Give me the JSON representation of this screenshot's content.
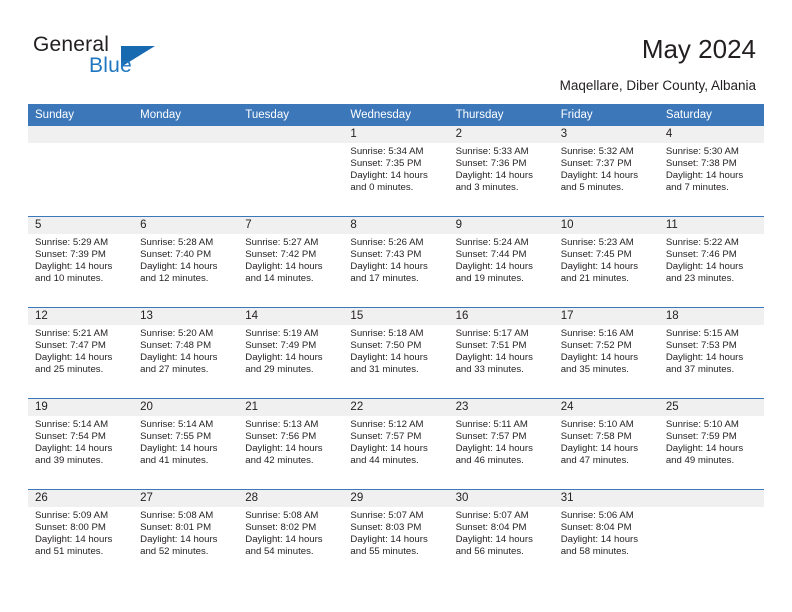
{
  "logo": {
    "word_general": "General",
    "word_blue": "Blue"
  },
  "header": {
    "title": "May 2024",
    "subtitle": "Maqellare, Diber County, Albania"
  },
  "calendar": {
    "weekday_headers": [
      "Sunday",
      "Monday",
      "Tuesday",
      "Wednesday",
      "Thursday",
      "Friday",
      "Saturday"
    ],
    "labels": {
      "sunrise": "Sunrise:",
      "sunset": "Sunset:",
      "daylight": "Daylight:"
    },
    "weeks": [
      [
        {
          "day": "",
          "empty": true
        },
        {
          "day": "",
          "empty": true
        },
        {
          "day": "",
          "empty": true
        },
        {
          "day": "1",
          "sunrise": "Sunrise: 5:34 AM",
          "sunset": "Sunset: 7:35 PM",
          "daylight1": "Daylight: 14 hours",
          "daylight2": "and 0 minutes."
        },
        {
          "day": "2",
          "sunrise": "Sunrise: 5:33 AM",
          "sunset": "Sunset: 7:36 PM",
          "daylight1": "Daylight: 14 hours",
          "daylight2": "and 3 minutes."
        },
        {
          "day": "3",
          "sunrise": "Sunrise: 5:32 AM",
          "sunset": "Sunset: 7:37 PM",
          "daylight1": "Daylight: 14 hours",
          "daylight2": "and 5 minutes."
        },
        {
          "day": "4",
          "sunrise": "Sunrise: 5:30 AM",
          "sunset": "Sunset: 7:38 PM",
          "daylight1": "Daylight: 14 hours",
          "daylight2": "and 7 minutes."
        }
      ],
      [
        {
          "day": "5",
          "sunrise": "Sunrise: 5:29 AM",
          "sunset": "Sunset: 7:39 PM",
          "daylight1": "Daylight: 14 hours",
          "daylight2": "and 10 minutes."
        },
        {
          "day": "6",
          "sunrise": "Sunrise: 5:28 AM",
          "sunset": "Sunset: 7:40 PM",
          "daylight1": "Daylight: 14 hours",
          "daylight2": "and 12 minutes."
        },
        {
          "day": "7",
          "sunrise": "Sunrise: 5:27 AM",
          "sunset": "Sunset: 7:42 PM",
          "daylight1": "Daylight: 14 hours",
          "daylight2": "and 14 minutes."
        },
        {
          "day": "8",
          "sunrise": "Sunrise: 5:26 AM",
          "sunset": "Sunset: 7:43 PM",
          "daylight1": "Daylight: 14 hours",
          "daylight2": "and 17 minutes."
        },
        {
          "day": "9",
          "sunrise": "Sunrise: 5:24 AM",
          "sunset": "Sunset: 7:44 PM",
          "daylight1": "Daylight: 14 hours",
          "daylight2": "and 19 minutes."
        },
        {
          "day": "10",
          "sunrise": "Sunrise: 5:23 AM",
          "sunset": "Sunset: 7:45 PM",
          "daylight1": "Daylight: 14 hours",
          "daylight2": "and 21 minutes."
        },
        {
          "day": "11",
          "sunrise": "Sunrise: 5:22 AM",
          "sunset": "Sunset: 7:46 PM",
          "daylight1": "Daylight: 14 hours",
          "daylight2": "and 23 minutes."
        }
      ],
      [
        {
          "day": "12",
          "sunrise": "Sunrise: 5:21 AM",
          "sunset": "Sunset: 7:47 PM",
          "daylight1": "Daylight: 14 hours",
          "daylight2": "and 25 minutes."
        },
        {
          "day": "13",
          "sunrise": "Sunrise: 5:20 AM",
          "sunset": "Sunset: 7:48 PM",
          "daylight1": "Daylight: 14 hours",
          "daylight2": "and 27 minutes."
        },
        {
          "day": "14",
          "sunrise": "Sunrise: 5:19 AM",
          "sunset": "Sunset: 7:49 PM",
          "daylight1": "Daylight: 14 hours",
          "daylight2": "and 29 minutes."
        },
        {
          "day": "15",
          "sunrise": "Sunrise: 5:18 AM",
          "sunset": "Sunset: 7:50 PM",
          "daylight1": "Daylight: 14 hours",
          "daylight2": "and 31 minutes."
        },
        {
          "day": "16",
          "sunrise": "Sunrise: 5:17 AM",
          "sunset": "Sunset: 7:51 PM",
          "daylight1": "Daylight: 14 hours",
          "daylight2": "and 33 minutes."
        },
        {
          "day": "17",
          "sunrise": "Sunrise: 5:16 AM",
          "sunset": "Sunset: 7:52 PM",
          "daylight1": "Daylight: 14 hours",
          "daylight2": "and 35 minutes."
        },
        {
          "day": "18",
          "sunrise": "Sunrise: 5:15 AM",
          "sunset": "Sunset: 7:53 PM",
          "daylight1": "Daylight: 14 hours",
          "daylight2": "and 37 minutes."
        }
      ],
      [
        {
          "day": "19",
          "sunrise": "Sunrise: 5:14 AM",
          "sunset": "Sunset: 7:54 PM",
          "daylight1": "Daylight: 14 hours",
          "daylight2": "and 39 minutes."
        },
        {
          "day": "20",
          "sunrise": "Sunrise: 5:14 AM",
          "sunset": "Sunset: 7:55 PM",
          "daylight1": "Daylight: 14 hours",
          "daylight2": "and 41 minutes."
        },
        {
          "day": "21",
          "sunrise": "Sunrise: 5:13 AM",
          "sunset": "Sunset: 7:56 PM",
          "daylight1": "Daylight: 14 hours",
          "daylight2": "and 42 minutes."
        },
        {
          "day": "22",
          "sunrise": "Sunrise: 5:12 AM",
          "sunset": "Sunset: 7:57 PM",
          "daylight1": "Daylight: 14 hours",
          "daylight2": "and 44 minutes."
        },
        {
          "day": "23",
          "sunrise": "Sunrise: 5:11 AM",
          "sunset": "Sunset: 7:57 PM",
          "daylight1": "Daylight: 14 hours",
          "daylight2": "and 46 minutes."
        },
        {
          "day": "24",
          "sunrise": "Sunrise: 5:10 AM",
          "sunset": "Sunset: 7:58 PM",
          "daylight1": "Daylight: 14 hours",
          "daylight2": "and 47 minutes."
        },
        {
          "day": "25",
          "sunrise": "Sunrise: 5:10 AM",
          "sunset": "Sunset: 7:59 PM",
          "daylight1": "Daylight: 14 hours",
          "daylight2": "and 49 minutes."
        }
      ],
      [
        {
          "day": "26",
          "sunrise": "Sunrise: 5:09 AM",
          "sunset": "Sunset: 8:00 PM",
          "daylight1": "Daylight: 14 hours",
          "daylight2": "and 51 minutes."
        },
        {
          "day": "27",
          "sunrise": "Sunrise: 5:08 AM",
          "sunset": "Sunset: 8:01 PM",
          "daylight1": "Daylight: 14 hours",
          "daylight2": "and 52 minutes."
        },
        {
          "day": "28",
          "sunrise": "Sunrise: 5:08 AM",
          "sunset": "Sunset: 8:02 PM",
          "daylight1": "Daylight: 14 hours",
          "daylight2": "and 54 minutes."
        },
        {
          "day": "29",
          "sunrise": "Sunrise: 5:07 AM",
          "sunset": "Sunset: 8:03 PM",
          "daylight1": "Daylight: 14 hours",
          "daylight2": "and 55 minutes."
        },
        {
          "day": "30",
          "sunrise": "Sunrise: 5:07 AM",
          "sunset": "Sunset: 8:04 PM",
          "daylight1": "Daylight: 14 hours",
          "daylight2": "and 56 minutes."
        },
        {
          "day": "31",
          "sunrise": "Sunrise: 5:06 AM",
          "sunset": "Sunset: 8:04 PM",
          "daylight1": "Daylight: 14 hours",
          "daylight2": "and 58 minutes."
        },
        {
          "day": "",
          "empty": true,
          "trailing": true
        }
      ]
    ]
  },
  "colors": {
    "header_blue": "#3b77b9",
    "logo_blue": "#2077c0",
    "daynum_band": "#f0f0f0",
    "text": "#231f20"
  }
}
